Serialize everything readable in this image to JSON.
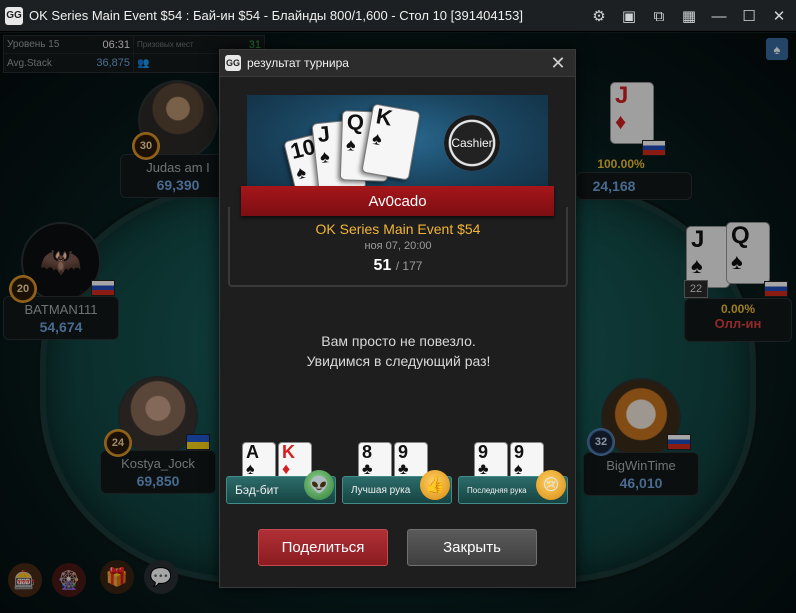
{
  "window": {
    "title": "OK Series Main Event $54 : Бай-ин $54 - Блайнды 800/1,600 - Стол 10 [391404153]",
    "logo": "GG"
  },
  "info": {
    "level_label": "Уровень 15",
    "level_time": "06:31",
    "paid_label": "Призовых мест",
    "paid_value": "31",
    "avg_label": "Avg.Stack",
    "avg_value": "36,875"
  },
  "players": [
    {
      "name": "Judas am I",
      "stack": "69,390",
      "level": "30"
    },
    {
      "name": "BATMAN111",
      "stack": "54,674",
      "level": "20"
    },
    {
      "name": "Kostya_Jock",
      "stack": "69,850",
      "level": "24"
    },
    {
      "name": "BigWinTime",
      "stack": "46,010",
      "level": "32"
    },
    {
      "name": "",
      "stack": "24,168",
      "level": "",
      "percent": "100.00%"
    },
    {
      "name": "",
      "stack": "",
      "level": "22",
      "percent": "0.00%",
      "status": "Олл-ин"
    }
  ],
  "table_cards": {
    "top_right": [
      {
        "rank": "J",
        "suit": "♦",
        "color": "red"
      }
    ],
    "right": [
      {
        "rank": "J",
        "suit": "♠"
      },
      {
        "rank": "Q",
        "suit": "♠"
      }
    ]
  },
  "modal": {
    "title": "результат турнира",
    "logo": "GG",
    "banner_cards": [
      "10",
      "J",
      "Q",
      "K"
    ],
    "cashier_label": "Cashier",
    "player_name": "Av0cado",
    "event_name": "OK Series Main Event $54",
    "event_date": "ноя 07, 20:00",
    "place": "51",
    "total": "/ 177",
    "message_line1": "Вам просто не повезло.",
    "message_line2": "Увидимся в следующий раз!",
    "awards": [
      {
        "label": "Бэд-бит",
        "cards": [
          {
            "rank": "A",
            "suit": "♠",
            "color": "black"
          },
          {
            "rank": "K",
            "suit": "♦",
            "color": "red"
          }
        ],
        "icon": "alien-emoji-icon"
      },
      {
        "label": "Лучшая рука",
        "cards": [
          {
            "rank": "8",
            "suit": "♣",
            "color": "black"
          },
          {
            "rank": "9",
            "suit": "♣",
            "color": "black"
          }
        ],
        "icon": "thumbs-up-emoji-icon"
      },
      {
        "label": "Последняя рука",
        "cards": [
          {
            "rank": "9",
            "suit": "♣",
            "color": "black"
          },
          {
            "rank": "9",
            "suit": "♠",
            "color": "black"
          }
        ],
        "icon": "crying-emoji-icon"
      }
    ],
    "share_label": "Поделиться",
    "close_label": "Закрыть"
  }
}
